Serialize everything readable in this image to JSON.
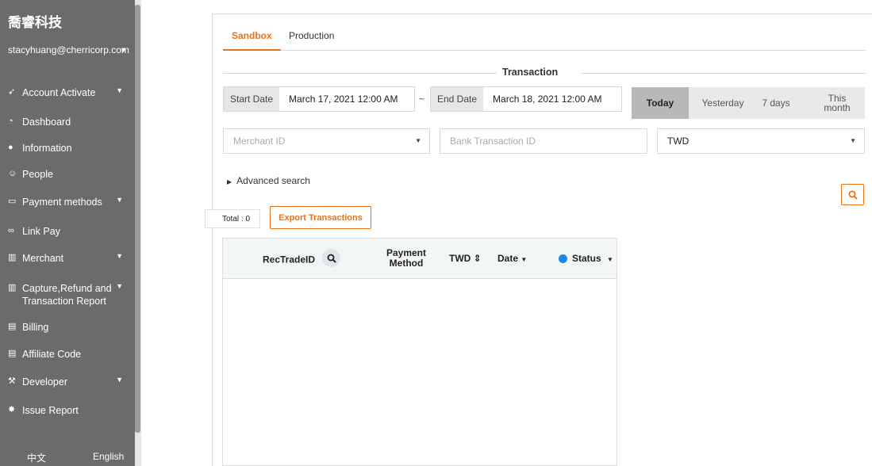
{
  "sidebar": {
    "brand": "喬睿科技",
    "account": "stacyhuang@cherricorp.com",
    "items": [
      {
        "label": "Account Activate",
        "icon": "rocket-icon"
      },
      {
        "label": "Dashboard",
        "icon": "dashboard-icon"
      },
      {
        "label": "Information",
        "icon": "info-icon"
      },
      {
        "label": "People",
        "icon": "people-icon"
      },
      {
        "label": "Payment methods",
        "icon": "card-icon"
      },
      {
        "label": "Link Pay",
        "icon": "link-icon"
      },
      {
        "label": "Merchant",
        "icon": "building-icon"
      },
      {
        "label": "Capture,Refund and Transaction Report",
        "icon": "building-icon"
      },
      {
        "label": "Billing",
        "icon": "document-icon"
      },
      {
        "label": "Affiliate Code",
        "icon": "document-icon"
      },
      {
        "label": "Developer",
        "icon": "wrench-icon"
      },
      {
        "label": "Issue Report",
        "icon": "bug-icon"
      }
    ],
    "lang_zh": "中文",
    "lang_en": "English"
  },
  "tabs": {
    "sandbox": "Sandbox",
    "production": "Production"
  },
  "section_title": "Transaction",
  "dates": {
    "start_label": "Start Date",
    "start_value": "March 17, 2021 12:00 AM",
    "tilde": "~",
    "end_label": "End Date",
    "end_value": "March 18, 2021 12:00 AM"
  },
  "quick": {
    "today": "Today",
    "yesterday": "Yesterday",
    "seven_days": "7 days",
    "this_month": "This month"
  },
  "filters": {
    "merchant_placeholder": "Merchant ID",
    "bank_placeholder": "Bank Transaction ID",
    "currency": "TWD"
  },
  "advanced": "Advanced search",
  "total": "Total : 0",
  "export": "Export Transactions",
  "table": {
    "col_rectrade": "RecTradeID",
    "col_payment": "Payment Method",
    "col_twd": "TWD ⇕",
    "col_date": "Date",
    "col_status": "Status"
  },
  "colors": {
    "accent": "#e8731b",
    "sidebar": "#6b6b6b",
    "status_dot": "#1e88e5"
  }
}
